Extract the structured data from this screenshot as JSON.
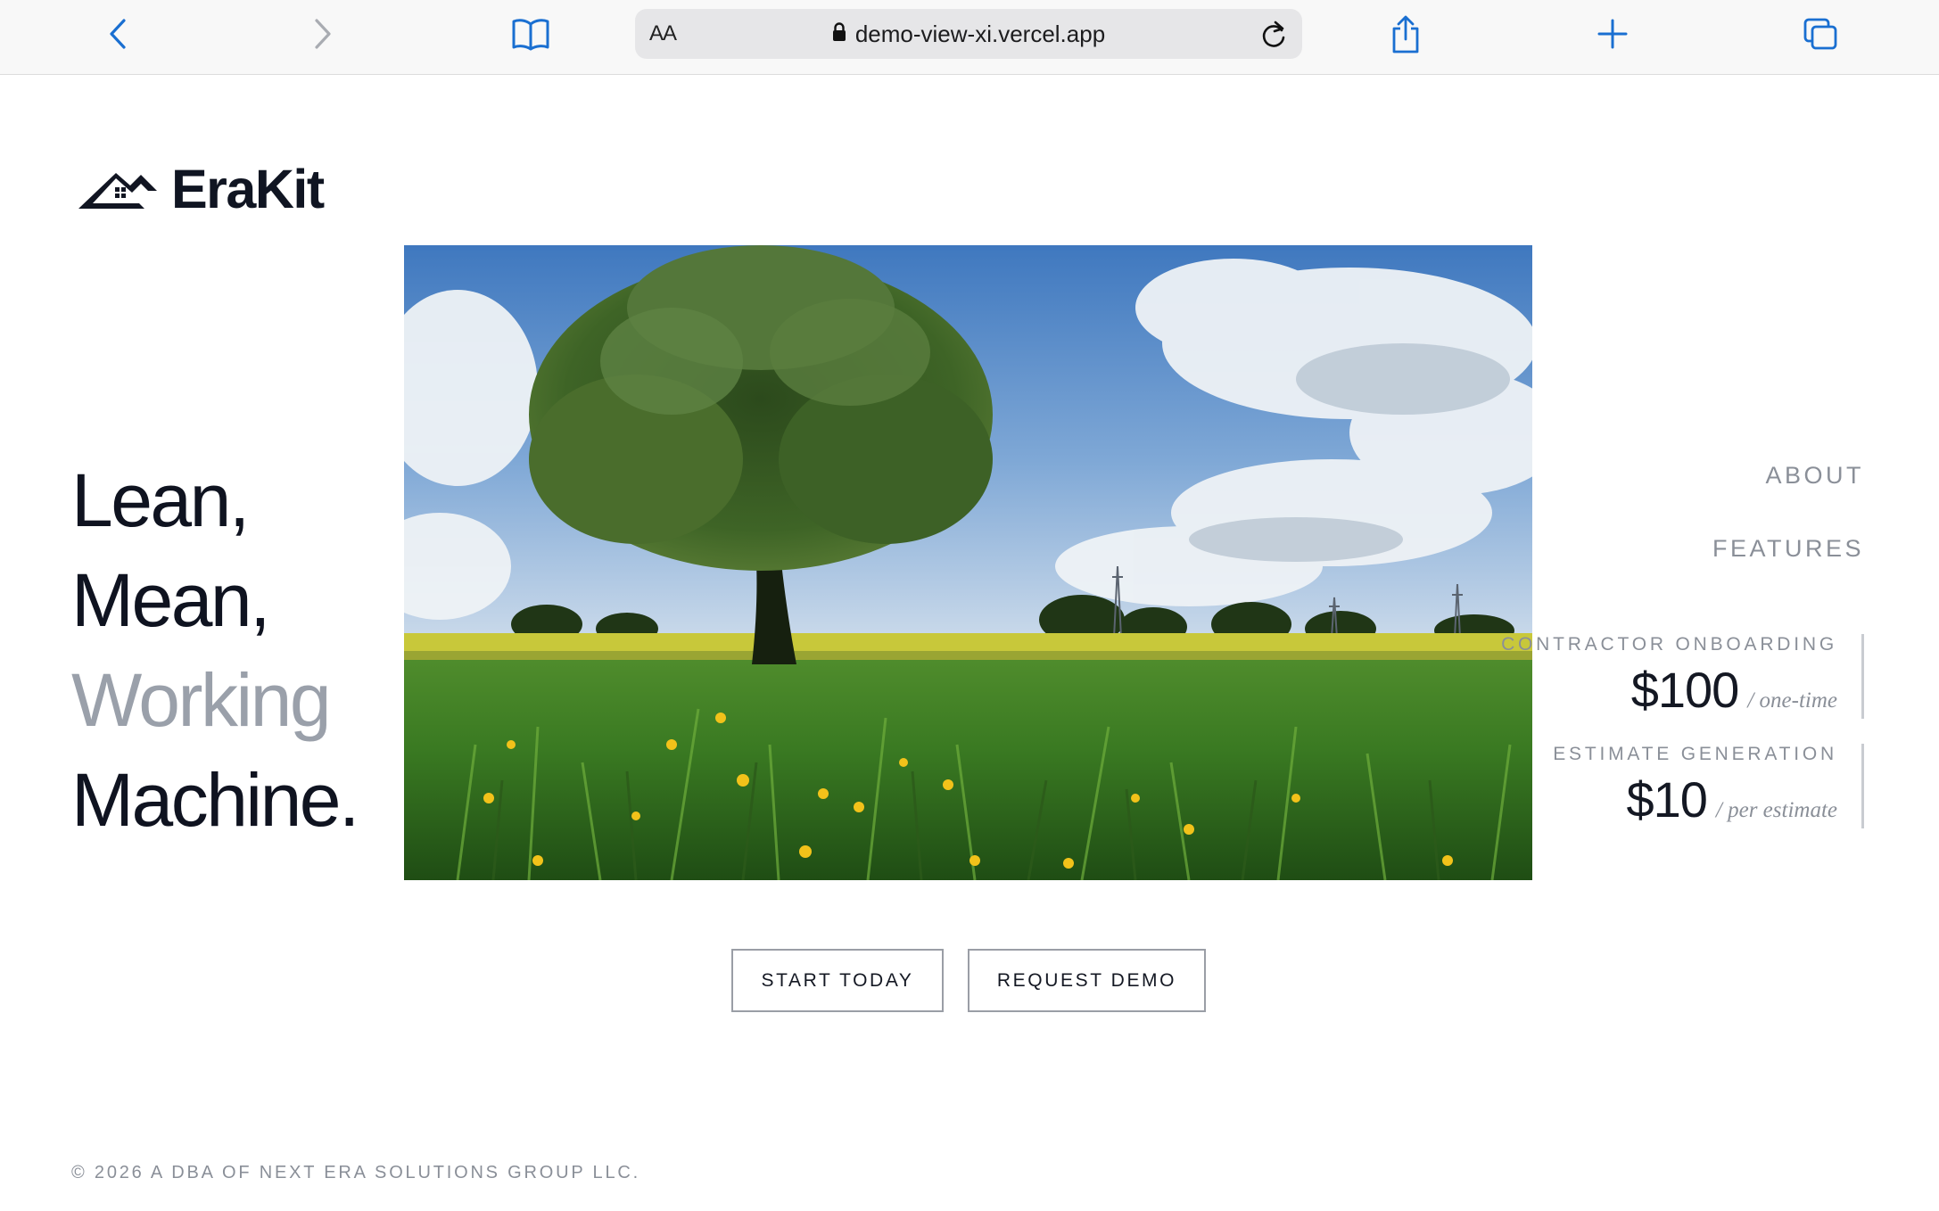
{
  "browser": {
    "aa_label": "AA",
    "url": "demo-view-xi.vercel.app",
    "icons": [
      "back-icon",
      "forward-icon",
      "bookmarks-icon",
      "lock-icon",
      "reload-icon",
      "share-icon",
      "new-tab-icon",
      "tabs-icon"
    ],
    "accent": "#1a6fd1"
  },
  "brand": {
    "name": "EraKit"
  },
  "headline": {
    "line1": "Lean,",
    "line2": "Mean,",
    "line3": "Working",
    "line4": "Machine."
  },
  "nav": {
    "about": "ABOUT",
    "features": "FEATURES"
  },
  "pricing": [
    {
      "label": "CONTRACTOR ONBOARDING",
      "amount": "$100",
      "unit": "/ one-time"
    },
    {
      "label": "ESTIMATE GENERATION",
      "amount": "$10",
      "unit": "/ per estimate"
    }
  ],
  "cta": {
    "start": "START TODAY",
    "demo": "REQUEST DEMO"
  },
  "footer": {
    "text": "© 2026 A DBA OF NEXT ERA SOLUTIONS GROUP LLC."
  },
  "colors": {
    "text": "#141823",
    "muted": "#8a8f98",
    "headline_muted": "#9aa0aa"
  }
}
